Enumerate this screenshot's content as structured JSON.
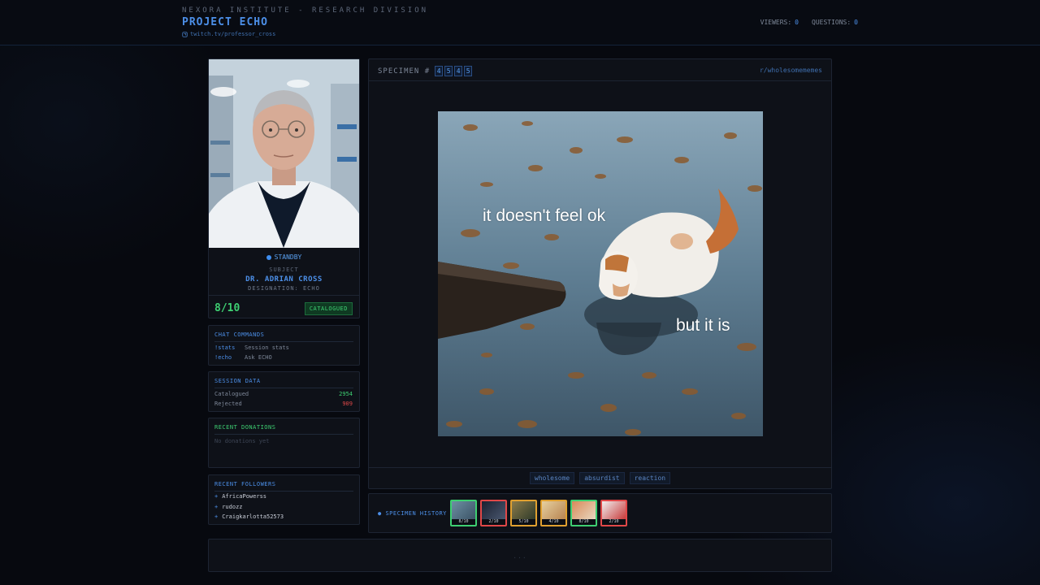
{
  "header": {
    "org": "NEXORA INSTITUTE - RESEARCH DIVISION",
    "title": "PROJECT ECHO",
    "link": "twitch.tv/professor_cross",
    "viewers_label": "VIEWERS:",
    "viewers_value": "0",
    "questions_label": "QUESTIONS:",
    "questions_value": "0"
  },
  "profile": {
    "status": "STANDBY",
    "subject_label": "SUBJECT",
    "name": "DR. ADRIAN CROSS",
    "designation": "DESIGNATION: ECHO",
    "score": "8/10",
    "badge": "CATALOGUED"
  },
  "commands": {
    "title": "CHAT COMMANDS",
    "items": [
      {
        "cmd": "!stats",
        "desc": "Session stats"
      },
      {
        "cmd": "!echo",
        "desc": "Ask ECHO"
      }
    ]
  },
  "session": {
    "title": "SESSION DATA",
    "catalogued_label": "Catalogued",
    "catalogued_value": "2954",
    "rejected_label": "Rejected",
    "rejected_value": "909"
  },
  "donations": {
    "title": "RECENT DONATIONS",
    "empty": "No donations yet"
  },
  "followers": {
    "title": "RECENT FOLLOWERS",
    "items": [
      "AfricaPowerss",
      "rudozz",
      "Craigkarlotta52573"
    ]
  },
  "specimen": {
    "label": "SPECIMEN #",
    "digits": [
      "4",
      "5",
      "4",
      "5"
    ],
    "subreddit": "r/wholesomememes",
    "caption_top": "it doesn't feel ok",
    "caption_bottom": "but it is",
    "tags": [
      "wholesome",
      "absurdist",
      "reaction"
    ]
  },
  "history": {
    "label": "SPECIMEN HISTORY",
    "items": [
      {
        "score": "8/10",
        "color": "#3ecf72"
      },
      {
        "score": "2/10",
        "color": "#e04848"
      },
      {
        "score": "5/10",
        "color": "#e0a030"
      },
      {
        "score": "4/10",
        "color": "#e0a030"
      },
      {
        "score": "8/10",
        "color": "#3ecf72"
      },
      {
        "score": "2/10",
        "color": "#e04848"
      }
    ]
  },
  "footer": {
    "placeholder": "..."
  },
  "colors": {
    "accent": "#4c8fe8",
    "success": "#3ecf72",
    "danger": "#e04848",
    "warning": "#e0a030"
  }
}
